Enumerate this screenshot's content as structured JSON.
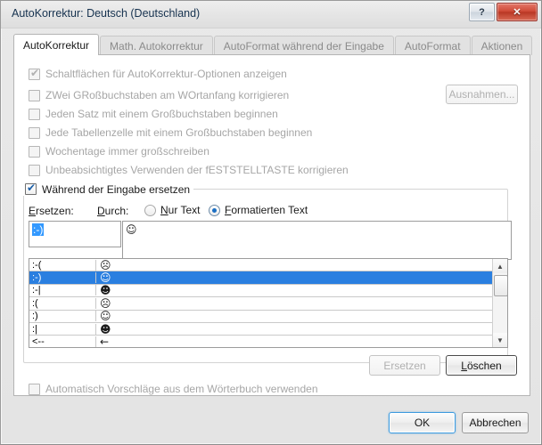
{
  "window": {
    "title": "AutoKorrektur: Deutsch (Deutschland)",
    "help_button": "?",
    "close_button": "✕"
  },
  "tabs": [
    {
      "label": "AutoKorrektur",
      "active": true
    },
    {
      "label": "Math. Autokorrektur",
      "active": false
    },
    {
      "label": "AutoFormat während der Eingabe",
      "active": false
    },
    {
      "label": "AutoFormat",
      "active": false
    },
    {
      "label": "Aktionen",
      "active": false
    }
  ],
  "options": [
    {
      "label": "Schaltflächen für AutoKorrektur-Optionen anzeigen",
      "checked": true,
      "enabled": false
    },
    {
      "label": "ZWei GRoßbuchstaben am WOrtanfang korrigieren",
      "checked": false,
      "enabled": false
    },
    {
      "label": "Jeden Satz mit einem Großbuchstaben beginnen",
      "checked": false,
      "enabled": false
    },
    {
      "label": "Jede Tabellenzelle mit einem Großbuchstaben beginnen",
      "checked": false,
      "enabled": false
    },
    {
      "label": "Wochentage immer großschreiben",
      "checked": false,
      "enabled": false
    },
    {
      "label": "Unbeabsichtigtes Verwenden der fESTSTELLTASTE korrigieren",
      "checked": false,
      "enabled": false
    }
  ],
  "exceptions_button": {
    "label": "Ausnahmen...",
    "enabled": false
  },
  "replace_group": {
    "checkbox_label": "Während der Eingabe ersetzen",
    "checked": true,
    "replace_label": "Ersetzen:",
    "with_label": "Durch:",
    "radio_plain": "Nur Text",
    "radio_formatted": "Formatierten Text",
    "selected_radio": "Formatierten Text",
    "replace_value": ":-)",
    "with_value": "☺"
  },
  "list": {
    "rows": [
      {
        "replace": ":-(",
        "with": "☹",
        "selected": false
      },
      {
        "replace": ":-)",
        "with": "☺",
        "selected": true
      },
      {
        "replace": ":-|",
        "with": "☻",
        "selected": false
      },
      {
        "replace": ":(",
        "with": "☹",
        "selected": false
      },
      {
        "replace": ":)",
        "with": "☺",
        "selected": false
      },
      {
        "replace": ":|",
        "with": "☻",
        "selected": false
      },
      {
        "replace": "<--",
        "with": "←",
        "selected": false
      }
    ],
    "scroll_up": "▲",
    "scroll_down": "▼"
  },
  "list_buttons": {
    "replace": {
      "label": "Ersetzen",
      "enabled": false
    },
    "delete": {
      "label": "Löschen",
      "enabled": true,
      "focused": true
    }
  },
  "dictionary_checkbox": {
    "label": "Automatisch Vorschläge aus dem Wörterbuch verwenden",
    "checked": false,
    "enabled": false
  },
  "dialog_buttons": {
    "ok": "OK",
    "cancel": "Abbrechen"
  }
}
